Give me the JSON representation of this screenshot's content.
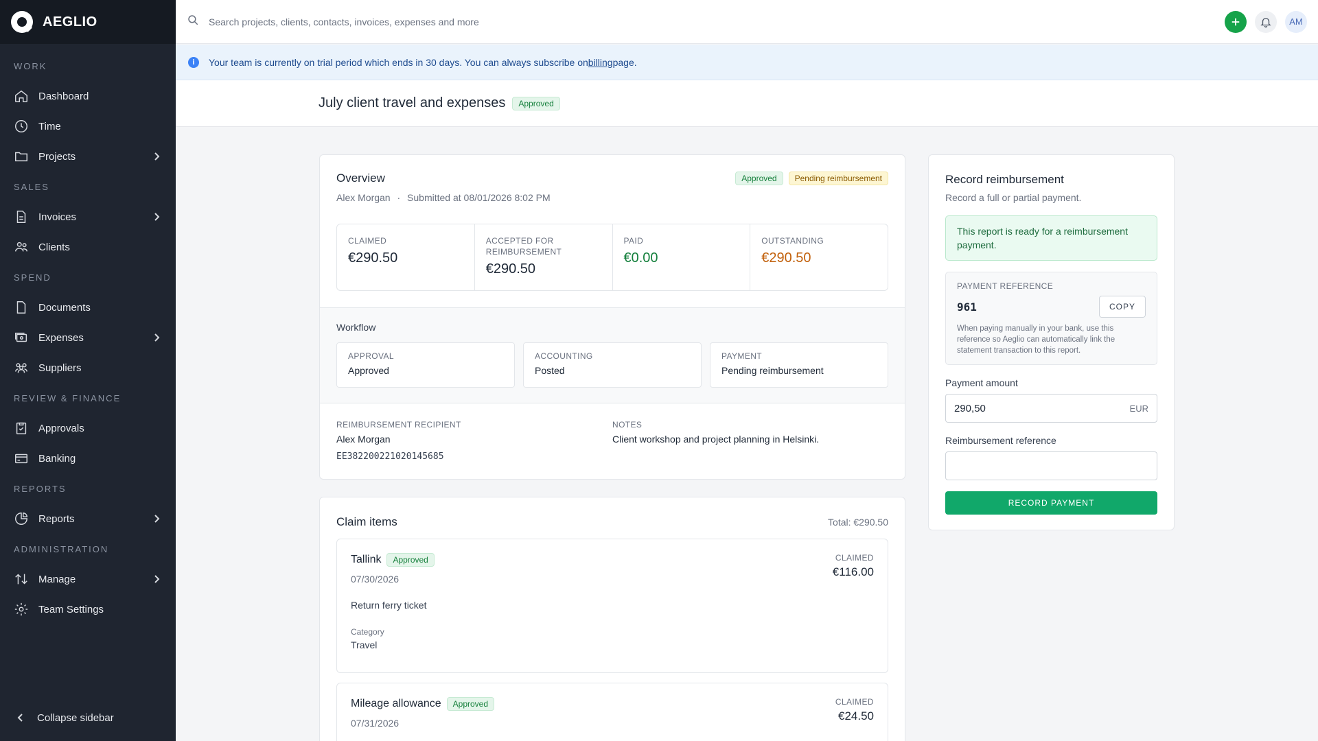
{
  "brand": {
    "name": "AEGLIO"
  },
  "search": {
    "placeholder": "Search projects, clients, contacts, invoices, expenses and more"
  },
  "user": {
    "initials": "AM"
  },
  "banner": {
    "text_before": "Your team is currently on trial period which ends in 30 days. You can always subscribe on ",
    "link": "billing",
    "text_after": " page."
  },
  "sidebar": {
    "sections": {
      "work": "WORK",
      "sales": "SALES",
      "spend": "SPEND",
      "review": "REVIEW & FINANCE",
      "reports": "REPORTS",
      "admin": "ADMINISTRATION"
    },
    "items": {
      "dashboard": "Dashboard",
      "time": "Time",
      "projects": "Projects",
      "invoices": "Invoices",
      "clients": "Clients",
      "documents": "Documents",
      "expenses": "Expenses",
      "suppliers": "Suppliers",
      "approvals": "Approvals",
      "banking": "Banking",
      "reports": "Reports",
      "manage": "Manage",
      "team_settings": "Team Settings"
    },
    "collapse": "Collapse sidebar"
  },
  "page": {
    "title": "July client travel and expenses",
    "status": "Approved"
  },
  "overview": {
    "title": "Overview",
    "person": "Alex Morgan",
    "separator": "·",
    "submitted": "Submitted at 08/01/2026 8:02 PM",
    "badges": {
      "approved": "Approved",
      "pending": "Pending reimbursement"
    },
    "stats": [
      {
        "label": "Claimed",
        "value": "€290.50"
      },
      {
        "label": "Accepted for reimbursement",
        "value": "€290.50"
      },
      {
        "label": "Paid",
        "value": "€0.00"
      },
      {
        "label": "Outstanding",
        "value": "€290.50"
      }
    ],
    "workflow": {
      "title": "Workflow",
      "steps": [
        {
          "label": "APPROVAL",
          "value": "Approved"
        },
        {
          "label": "ACCOUNTING",
          "value": "Posted"
        },
        {
          "label": "PAYMENT",
          "value": "Pending reimbursement"
        }
      ]
    },
    "recipient": {
      "label": "REIMBURSEMENT RECIPIENT",
      "name": "Alex Morgan",
      "iban": "EE382200221020145685"
    },
    "notes": {
      "label": "NOTES",
      "value": "Client workshop and project planning in Helsinki."
    }
  },
  "claims": {
    "title": "Claim items",
    "total": "Total: €290.50",
    "items": [
      {
        "name": "Tallink",
        "status": "Approved",
        "date": "07/30/2026",
        "description": "Return ferry ticket",
        "category_label": "Category",
        "category": "Travel",
        "amount_label": "CLAIMED",
        "amount": "€116.00"
      },
      {
        "name": "Mileage allowance",
        "status": "Approved",
        "date": "07/31/2026",
        "amount_label": "CLAIMED",
        "amount": "€24.50"
      }
    ]
  },
  "reimbursement": {
    "title": "Record reimbursement",
    "subtitle": "Record a full or partial payment.",
    "ready_message": "This report is ready for a reimbursement payment.",
    "payment_reference_label": "PAYMENT REFERENCE",
    "payment_reference": "961",
    "copy_label": "COPY",
    "note": "When paying manually in your bank, use this reference so Aeglio can automatically link the statement transaction to this report.",
    "amount_label": "Payment amount",
    "amount_value": "290,50",
    "currency": "EUR",
    "reference_label": "Reimbursement reference",
    "reference_value": "",
    "button": "RECORD PAYMENT"
  }
}
